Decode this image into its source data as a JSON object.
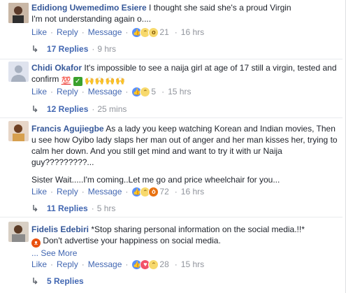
{
  "actions": {
    "like": "Like",
    "reply": "Reply",
    "message": "Message",
    "separator": "·"
  },
  "comments": [
    {
      "author": "Edidiong Uwemedimo Esiere",
      "text": "I thought she said she's a proud Virgin",
      "text2": "I'm not understanding again o....",
      "reactions": [
        "like",
        "haha",
        "wow"
      ],
      "reaction_count": "21",
      "time": "16 hrs",
      "replies_label": "17 Replies",
      "replies_time": "9 hrs",
      "avatar_color": "#6b4a3a"
    },
    {
      "author": "Chidi Okafor",
      "text": "It's impossible to see a naija girl at age of 17 still a virgin, tested and confirm",
      "emoji": [
        "100",
        "check-mark",
        "raised-hands"
      ],
      "reactions": [
        "like",
        "haha"
      ],
      "reaction_count": "5",
      "time": "15 hrs",
      "replies_label": "12 Replies",
      "replies_time": "25 mins",
      "avatar_color": "#cfd6e0"
    },
    {
      "author": "Francis Agujiegbe",
      "text": "As a lady you keep watching Korean and Indian movies, Then u see how Oyibo lady slaps her man out of anger and her man kisses her, trying to calm her down. And you still get mind and want to try it with ur Naija guy?????????...",
      "text2": "Sister Wait.....I'm coming..Let me go and price wheelchair for you...",
      "reactions": [
        "like",
        "haha",
        "angry"
      ],
      "reaction_count": "72",
      "time": "16 hrs",
      "replies_label": "11 Replies",
      "replies_time": "5 hrs",
      "avatar_color": "#8a5a3c"
    },
    {
      "author": "Fidelis Edebiri",
      "text": "*Stop sharing personal information on the social media.!!*",
      "emoji": [
        "devil"
      ],
      "text2": "Don't advertise your happiness on social media.",
      "see_more": "... See More",
      "reactions": [
        "like",
        "love",
        "haha"
      ],
      "reaction_count": "28",
      "time": "15 hrs",
      "replies_label": "5 Replies",
      "avatar_color": "#7a6a5a"
    }
  ]
}
